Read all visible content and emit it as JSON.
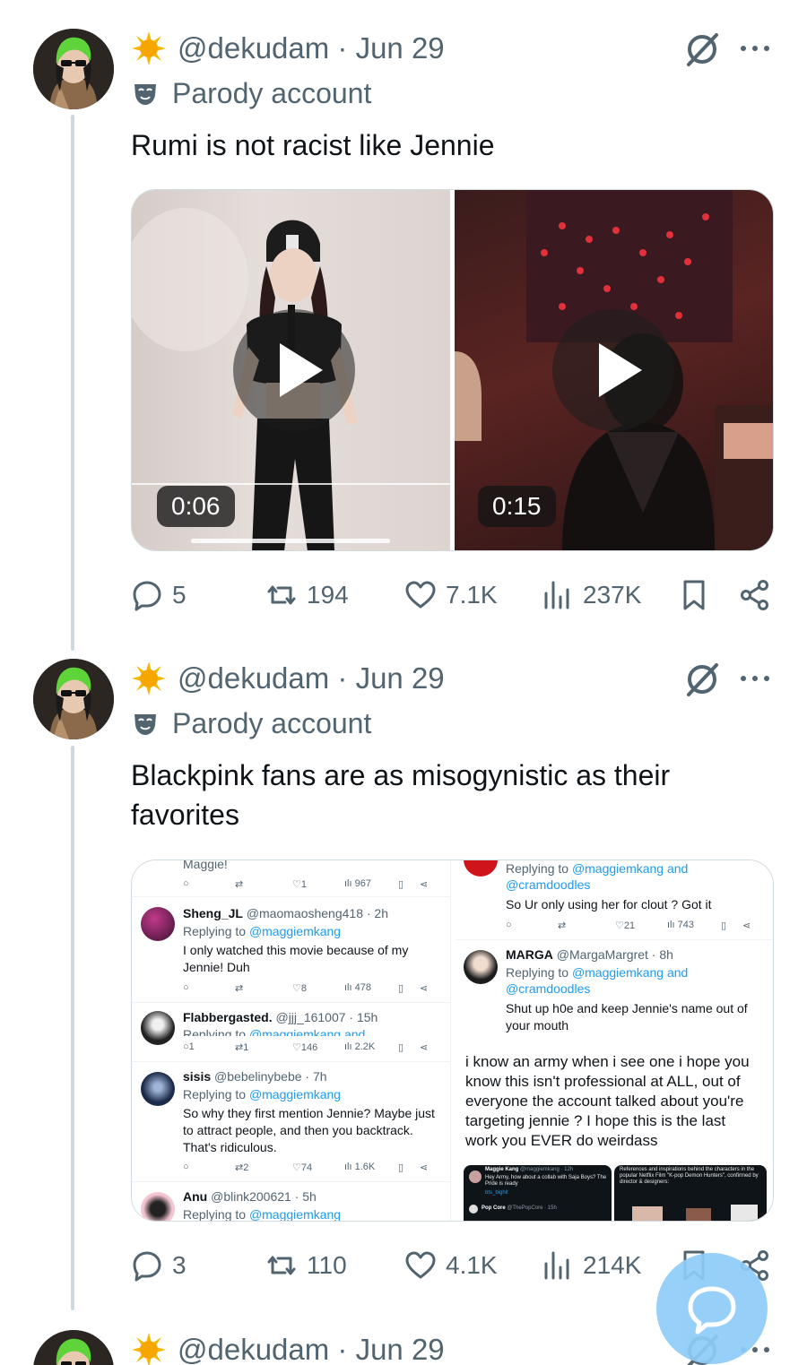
{
  "tweets": [
    {
      "handle_date": "@dekudam · Jun 29",
      "parody_label": "Parody account",
      "text": "Rumi is not racist like Jennie",
      "media": {
        "videos": [
          {
            "duration": "0:06"
          },
          {
            "duration": "0:15"
          }
        ]
      },
      "stats": {
        "replies": "5",
        "reposts": "194",
        "likes": "7.1K",
        "views": "237K"
      }
    },
    {
      "handle_date": "@dekudam · Jun 29",
      "parody_label": "Parody account",
      "text": "Blackpink fans are as misogynistic as their favorites",
      "media": {
        "left_column": {
          "top_name": "Maggie!",
          "top_acts": {
            "likes": "1",
            "views": "967"
          },
          "replies": [
            {
              "name": "Sheng_JL",
              "meta": "@maomaosheng418 · 2h",
              "replying": "Replying to ",
              "replying_to": "@maggiemkang",
              "body": "I only watched this movie because of my Jennie!  Duh",
              "acts": {
                "replies": "",
                "reposts": "",
                "likes": "8",
                "views": "478"
              }
            },
            {
              "name": "Flabbergasted.",
              "meta": "@jjj_161007 · 15h",
              "replying": "Replying to ",
              "replying_to": "@maggiemkang and",
              "body": "",
              "acts": {
                "replies": "1",
                "reposts": "1",
                "likes": "146",
                "views": "2.2K"
              }
            },
            {
              "name": "sisis",
              "meta": "@bebelinybebe · 7h",
              "replying": "Replying to ",
              "replying_to": "@maggiemkang",
              "body": "So why they first mention Jennie? Maybe just to attract people, and then you backtrack. That's ridiculous.",
              "acts": {
                "replies": "",
                "reposts": "2",
                "likes": "74",
                "views": "1.6K"
              }
            },
            {
              "name": "Anu",
              "meta": "@blink200621 · 5h",
              "replying": "Replying to ",
              "replying_to": "@maggiemkang",
              "body": "",
              "acts": {}
            }
          ]
        },
        "right_column": {
          "top_replying": "Replying to ",
          "top_replying_to": "@maggiemkang and",
          "top_replying_to_2": "@cramdoodles",
          "top_body": "So Ur only using her for clout ? Got it",
          "top_acts": {
            "likes": "21",
            "views": "743"
          },
          "reply": {
            "name": "MARGA",
            "meta": "@MargaMargret · 8h",
            "replying": "Replying to ",
            "replying_to": "@maggiemkang and",
            "replying_to_2": "@cramdoodles",
            "body": "Shut up h0e and keep Jennie's name out of your mouth"
          },
          "quote": "i know an army when i see one i hope you know this isn't professional at ALL, out of everyone the account talked about you're targeting jennie ? I hope this is the last work you EVER do weirdass",
          "thumb_a": {
            "name": "Maggie Kang",
            "handle": "@maggiemkang · 12h",
            "body": "Hey Army, how about a collab with Saja Boys? The Pride is ready",
            "link": "bts_bighit",
            "foot_name": "Pop Core",
            "foot_handle": "@ThePopCore · 15h"
          },
          "thumb_b": {
            "body": "References and inspirations behind the characters in the popular Netflix Film \"K-pop Demon Hunters\", confirmed by director & designers:"
          }
        }
      },
      "stats": {
        "replies": "3",
        "reposts": "110",
        "likes": "4.1K",
        "views": "214K"
      }
    },
    {
      "handle_date": "@dekudam · Jun 29"
    }
  ],
  "icons": {
    "verified_badge": "sun-badge-icon",
    "parody": "mask-icon",
    "grok": "grok-icon",
    "more": "more-dots-icon",
    "reply": "reply-icon",
    "repost": "repost-icon",
    "like": "heart-icon",
    "views": "views-icon",
    "bookmark": "bookmark-icon",
    "share": "share-icon",
    "compose": "compose-icon"
  },
  "colors": {
    "accent": "#1d9bf0",
    "secondary_text": "#536471",
    "badge": "#f5b800",
    "fab": "#8ecdf8"
  }
}
